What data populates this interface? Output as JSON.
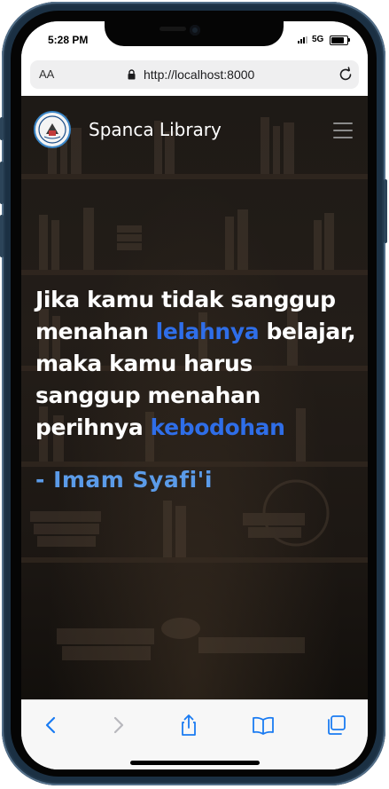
{
  "status": {
    "time": "5:28 PM",
    "network": "5G"
  },
  "browser": {
    "text_size": "AA",
    "url": "http://localhost:8000"
  },
  "nav": {
    "brand": "Spanca Library"
  },
  "quote": {
    "t1": "Jika kamu tidak sanggup menahan ",
    "h1": "lelahnya",
    "t2": " belajar, maka kamu harus sanggup menahan perihnya ",
    "h2": "kebodohan",
    "author": "- Imam Syafi'i"
  },
  "colors": {
    "accent": "#2f6ee8",
    "author": "#5b9be8",
    "toolbar_icon": "#1a7bf2",
    "toolbar_icon_disabled": "#b8b8bd"
  },
  "toolbar": {
    "icons": [
      "back-icon",
      "forward-icon",
      "share-icon",
      "bookmarks-icon",
      "tabs-icon"
    ]
  }
}
